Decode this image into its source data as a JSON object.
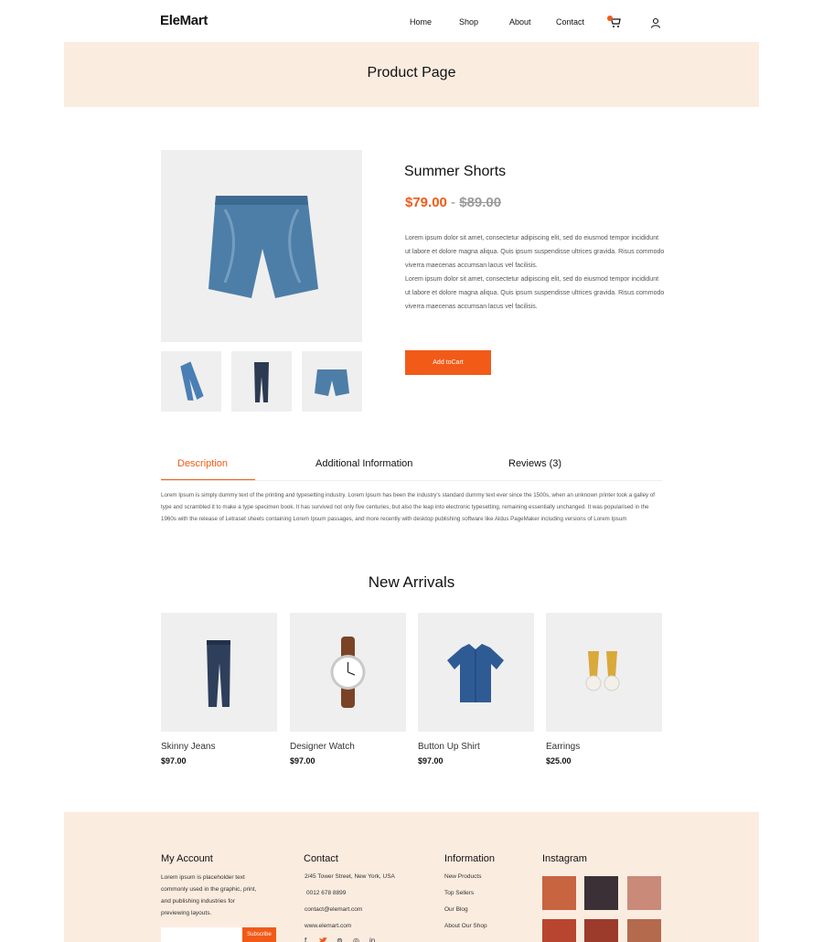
{
  "brand": {
    "logo": "EleMart"
  },
  "nav": {
    "items": [
      "Home",
      "Shop",
      "About",
      "Contact"
    ],
    "cart_count": ""
  },
  "banner": {
    "title": "Product Page"
  },
  "product": {
    "title": "Summer Shorts",
    "price": "$79.00",
    "price_separator": " - ",
    "old_price": "$89.00",
    "description_lines": [
      "Lorem ipsum dolor sit amet, consectetur adipiscing elit, sed do eiusmod tempor incididunt",
      "ut labore et dolore magna aliqua. Quis ipsum suspendisse ultrices gravida. Risus commodo",
      "viverra maecenas accumsan lacus vel facilisis.",
      "Lorem ipsum dolor sit amet, consectetur adipiscing elit, sed do eiusmod tempor incididunt",
      "ut labore et dolore magna aliqua. Quis ipsum suspendisse ultrices gravida. Risus commodo",
      "viverra maecenas accumsan lacus vel facilisis."
    ],
    "add_to_cart": "Add toCart"
  },
  "tabs": {
    "items": [
      "Description",
      "Additional Information",
      "Reviews (3)"
    ],
    "active": "Description",
    "content": "Lorem Ipsum is simply dummy text of the printing and typesetting industry. Lorem Ipsum has been the industry's standard dummy text ever since the 1500s, when an unknown printer took a galley of type and scrambled it to make a type specimen book. It has survived not only five centuries, but also the leap into electronic typesetting, remaining essentially unchanged. It was popularised in the 1960s with the release of Letraset sheets containing Lorem Ipsum passages, and more recently with desktop publishing software like Aldus PageMaker including versions of Lorem Ipsum"
  },
  "arrivals": {
    "title": "New Arrivals",
    "items": [
      {
        "name": "Skinny Jeans",
        "price": "$97.00",
        "icon": "jeans-icon"
      },
      {
        "name": "Designer Watch",
        "price": "$97.00",
        "icon": "watch-icon"
      },
      {
        "name": "Button Up Shirt",
        "price": "$97.00",
        "icon": "shirt-icon"
      },
      {
        "name": "Earrings",
        "price": "$25.00",
        "icon": "earrings-icon"
      }
    ]
  },
  "footer": {
    "account": {
      "title": "My Account",
      "text_lines": [
        "Lorem ipsum is placeholder text",
        "commonly used in the graphic, print,",
        "and publishing industries for",
        "previewing layouts."
      ],
      "subscribe_label": "Subscribe",
      "subscribe_placeholder": ""
    },
    "contact": {
      "title": "Contact",
      "lines": [
        "2/45 Tower Street, New York, USA",
        "0012 678 8899",
        "contact@elemart.com",
        "www.elemart.com"
      ]
    },
    "information": {
      "title": "Information",
      "links": [
        "New Products",
        "Top Sellers",
        "Our Blog",
        "About Our Shop"
      ]
    },
    "instagram": {
      "title": "Instagram"
    }
  },
  "colors": {
    "accent": "#f25a18",
    "banner_bg": "#fbece0",
    "image_bg": "#efefef"
  }
}
